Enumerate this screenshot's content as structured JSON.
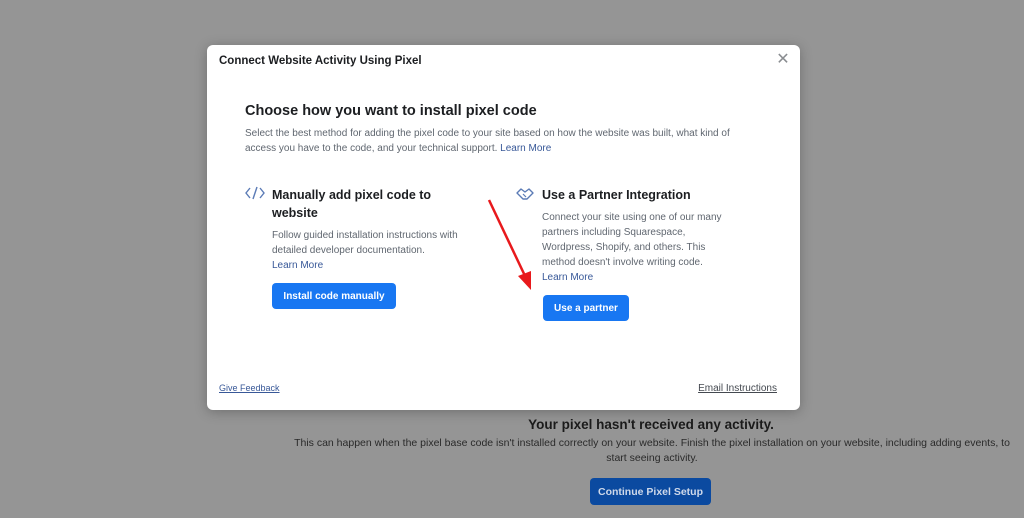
{
  "background": {
    "status_title": "Your pixel hasn't received any activity.",
    "status_desc": "This can happen when the pixel base code isn't installed correctly on your website. Finish the pixel installation on your website, including adding events, to start seeing activity.",
    "continue_label": "Continue Pixel Setup"
  },
  "modal": {
    "title": "Connect Website Activity Using Pixel",
    "close_glyph": "✕",
    "heading": "Choose how you want to install pixel code",
    "intro": "Select the best method for adding the pixel code to your site based on how the website was built, what kind of access you have to the code, and your technical support.",
    "intro_link": "Learn More",
    "manual": {
      "icon_glyph": "</>",
      "title": "Manually add pixel code to website",
      "desc": "Follow guided installation instructions with detailed developer documentation.",
      "link": "Learn More",
      "button": "Install code manually"
    },
    "partner": {
      "icon_glyph": "⇄",
      "title": "Use a Partner Integration",
      "desc": "Connect your site using one of our many partners including Squarespace, Wordpress, Shopify, and others. This method doesn't involve writing code.",
      "link": "Learn More",
      "button": "Use a partner"
    },
    "feedback": "Give Feedback",
    "email": "Email Instructions"
  },
  "colors": {
    "primary": "#1877f2",
    "link": "#385898",
    "overlay": "#959595",
    "annotation_arrow": "#e8191c"
  }
}
